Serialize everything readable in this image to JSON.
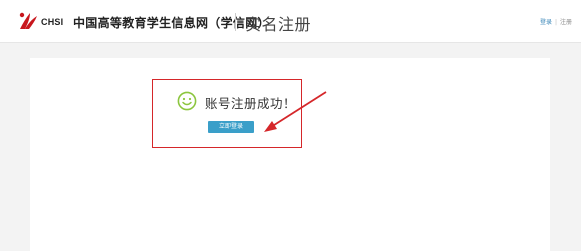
{
  "header": {
    "logo_text": "CHSI",
    "site_name": "中国高等教育学生信息网（学信网）",
    "page_title": "实名注册",
    "links": {
      "login": "登录",
      "register": "注册"
    }
  },
  "main": {
    "success_message": "账号注册成功！",
    "login_button": "立即登录"
  },
  "colors": {
    "accent": "#3a9fc9",
    "annotation": "#d5272a",
    "icon": "#8cc63f"
  },
  "icons": [
    "chsi-logo-icon",
    "smile-icon",
    "annotation-arrow"
  ]
}
